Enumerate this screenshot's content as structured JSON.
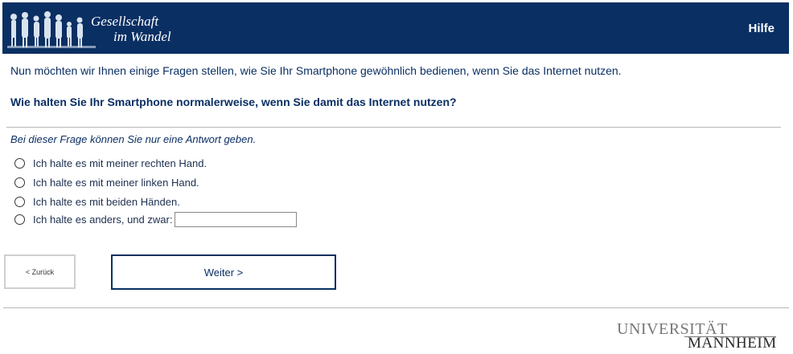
{
  "header": {
    "logo_line1": "Gesellschaft",
    "logo_line2": "im Wandel",
    "help_label": "Hilfe"
  },
  "survey": {
    "intro": "Nun möchten wir Ihnen einige Fragen stellen, wie Sie Ihr Smartphone gewöhnlich bedienen, wenn Sie das Internet nutzen.",
    "question": "Wie halten Sie Ihr Smartphone normalerweise, wenn Sie damit das Internet nutzen?",
    "hint": "Bei dieser Frage können Sie nur eine Antwort geben.",
    "options": [
      {
        "label": "Ich halte es mit meiner rechten Hand.",
        "selected": false
      },
      {
        "label": "Ich halte es mit meiner linken Hand.",
        "selected": false
      },
      {
        "label": "Ich halte es mit beiden Händen.",
        "selected": false
      },
      {
        "label": "Ich halte es anders, und zwar:",
        "selected": false
      }
    ],
    "other_value": ""
  },
  "nav": {
    "back_label": "< Zurück",
    "next_label": "Weiter >"
  },
  "footer": {
    "university_line1": "UNIVERSITÄT",
    "university_line2": "MANNHEIM"
  },
  "colors": {
    "brand": "#0a2f63",
    "rule": "#b8b8b8"
  }
}
